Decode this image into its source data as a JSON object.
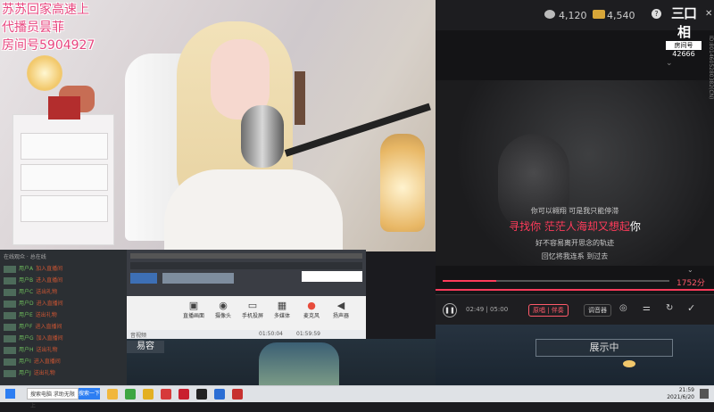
{
  "overlay": {
    "line1": "苏苏回家高速上",
    "line2": "代播员昙菲",
    "line3": "房间号5904927"
  },
  "player": {
    "coin1": "4,120",
    "coin2": "4,540",
    "room_logo": "三口相",
    "room_label": "房间号",
    "room_number": "42666",
    "side_text": "ID:8014605280382(CN)",
    "lyrics": {
      "prev": "你可以翱翔 可是我只能停滞",
      "current_left": "寻找你",
      "current_sung": "茫茫人海却又想起",
      "current_rest": "你",
      "next1": "好不容易离开思念的轨迹",
      "next2": "回忆将我连系 到过去"
    },
    "score": "1752分",
    "time": "02:49 | 05:00",
    "btn_a": "原唱 | 伴奏",
    "btn_b": "调音器",
    "showing": "展示中",
    "colors": {
      "accent": "#e8467f",
      "lyric_sung": "#ff3b5a",
      "score": "#ff5a6a"
    }
  },
  "chat": {
    "header": "在线观众 · 总在线",
    "rows": [
      {
        "name": "用户A",
        "msg": "加入直播间"
      },
      {
        "name": "用户B",
        "msg": "进入直播间"
      },
      {
        "name": "用户C",
        "msg": "送出礼物"
      },
      {
        "name": "用户D",
        "msg": "进入直播间"
      },
      {
        "name": "用户E",
        "msg": "送出礼物"
      },
      {
        "name": "用户F",
        "msg": "进入直播间"
      },
      {
        "name": "用户G",
        "msg": "加入直播间"
      },
      {
        "name": "用户H",
        "msg": "送出礼物"
      },
      {
        "name": "用户I",
        "msg": "进入直播间"
      },
      {
        "name": "用户J",
        "msg": "送出礼物"
      }
    ]
  },
  "tools": {
    "items": [
      "直播画面",
      "摄像头",
      "手机投屏",
      "多媒体",
      "麦克风",
      "扬声器"
    ]
  },
  "strip": {
    "left": "音视频",
    "time1": "01:50:04",
    "time2": "01:59:59"
  },
  "bottom_tab": "易容",
  "taskbar": {
    "search_text": "搜索电脑 求助无限上",
    "search_btn": "搜索一下",
    "time": "21:59",
    "date": "2021/6/20"
  }
}
